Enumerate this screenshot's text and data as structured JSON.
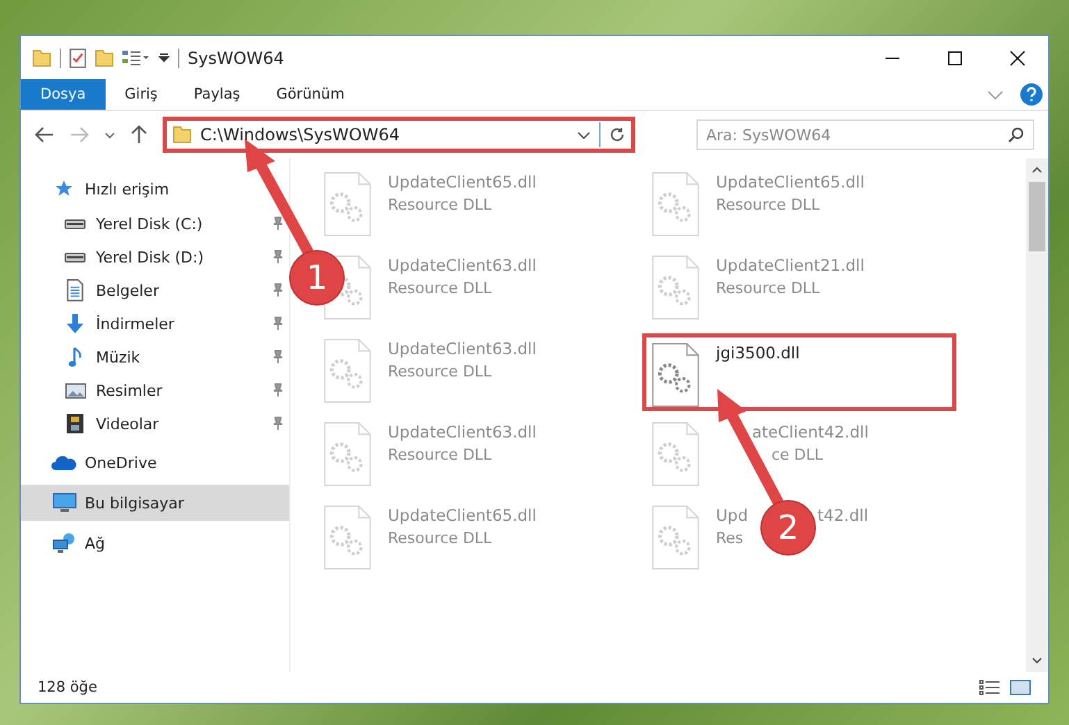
{
  "window": {
    "title": "SysWOW64"
  },
  "ribbon_tabs": [
    {
      "label": "Dosya",
      "selected": true
    },
    {
      "label": "Giriş",
      "selected": false
    },
    {
      "label": "Paylaş",
      "selected": false
    },
    {
      "label": "Görünüm",
      "selected": false
    }
  ],
  "address": {
    "value": "C:\\Windows\\SysWOW64",
    "highlighted": true
  },
  "search": {
    "placeholder": "Ara: SysWOW64"
  },
  "sidebar": {
    "items": [
      {
        "label": "Hızlı erişim",
        "kind": "star",
        "pinned": false,
        "selected": false,
        "children": [
          {
            "label": "Yerel Disk (C:)",
            "kind": "drive",
            "pinned": true,
            "selected": false
          },
          {
            "label": "Yerel Disk (D:)",
            "kind": "drive",
            "pinned": true,
            "selected": false
          },
          {
            "label": "Belgeler",
            "kind": "document",
            "pinned": true,
            "selected": false
          },
          {
            "label": "İndirmeler",
            "kind": "download",
            "pinned": true,
            "selected": false
          },
          {
            "label": "Müzik",
            "kind": "music",
            "pinned": true,
            "selected": false
          },
          {
            "label": "Resimler",
            "kind": "picture",
            "pinned": true,
            "selected": false
          },
          {
            "label": "Videolar",
            "kind": "video",
            "pinned": true,
            "selected": false
          }
        ]
      },
      {
        "label": "OneDrive",
        "kind": "cloud",
        "pinned": false,
        "selected": false
      },
      {
        "label": "Bu bilgisayar",
        "kind": "computer",
        "pinned": false,
        "selected": true
      },
      {
        "label": "Ağ",
        "kind": "network",
        "pinned": false,
        "selected": false
      }
    ]
  },
  "files": [
    {
      "name": "UpdateClient65.dll",
      "type": "Resource DLL",
      "faded": true,
      "highlighted": false
    },
    {
      "name": "UpdateClient65.dll",
      "type": "Resource DLL",
      "faded": true,
      "highlighted": false
    },
    {
      "name": "UpdateClient63.dll",
      "type": "Resource DLL",
      "faded": true,
      "highlighted": false
    },
    {
      "name": "UpdateClient21.dll",
      "type": "Resource DLL",
      "faded": true,
      "highlighted": false
    },
    {
      "name": "UpdateClient63.dll",
      "type": "Resource DLL",
      "faded": true,
      "highlighted": false
    },
    {
      "name": "jgi3500.dll",
      "faded": false,
      "highlighted": true
    },
    {
      "name": "UpdateClient63.dll",
      "type": "Resource DLL",
      "faded": true,
      "highlighted": false
    },
    {
      "name_parts": [
        {
          "text": "ateClient42.dll",
          "covered_before": true
        }
      ],
      "type_parts": [
        {
          "text": "ce DLL",
          "covered_before": true
        }
      ],
      "faded": true,
      "highlighted": false
    },
    {
      "name": "UpdateClient65.dll",
      "type": "Resource DLL",
      "faded": true,
      "highlighted": false
    },
    {
      "name_parts": [
        {
          "text": "Upd",
          "covered_before": false
        },
        {
          "text": "t42.dll",
          "covered_before": true
        }
      ],
      "type_parts": [
        {
          "text": "Res",
          "covered_before": false
        }
      ],
      "faded": true,
      "highlighted": false
    }
  ],
  "callouts": [
    {
      "number": "1"
    },
    {
      "number": "2"
    }
  ],
  "status_bar": {
    "count": "128 öğe"
  }
}
